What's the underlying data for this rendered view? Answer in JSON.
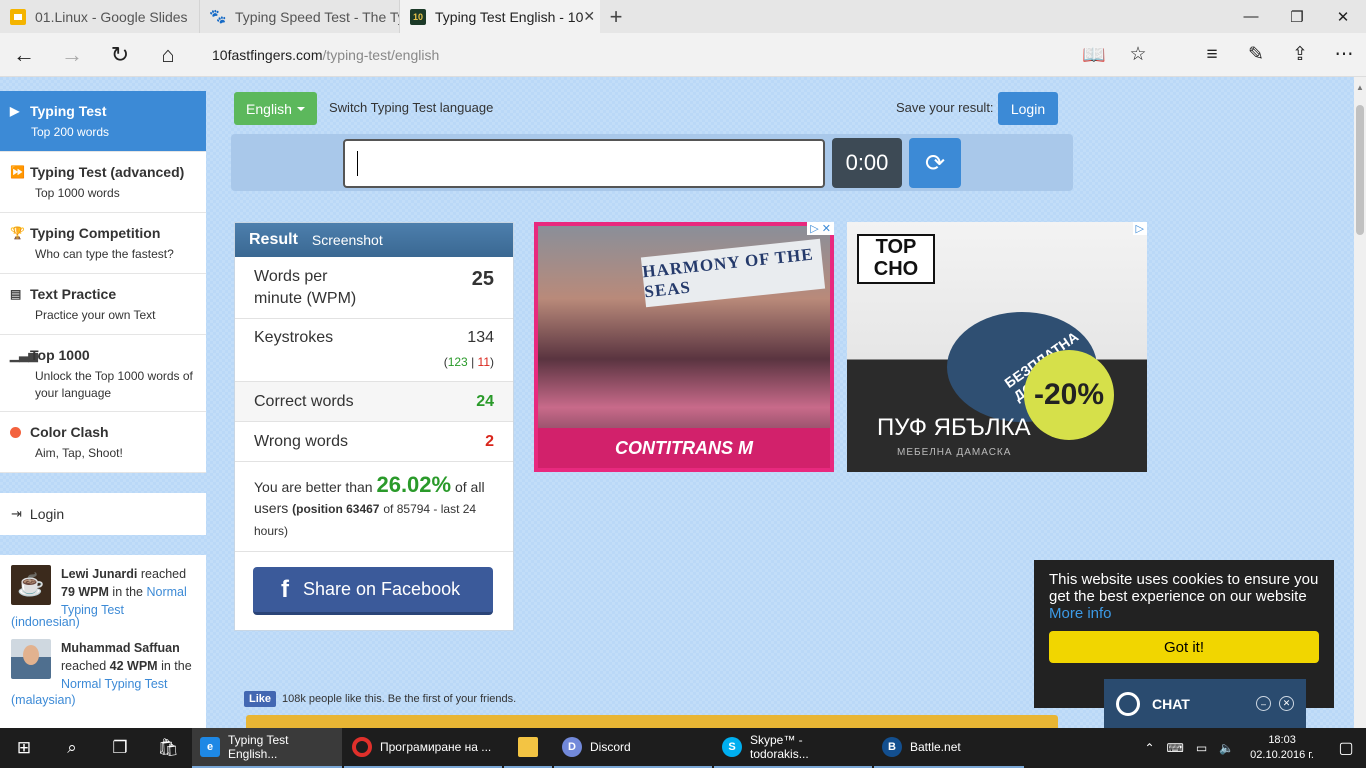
{
  "browser": {
    "tabs": [
      {
        "title": "01.Linux - Google Slides",
        "icon": "slides-icon"
      },
      {
        "title": "Typing Speed Test - The Typ",
        "icon": "paw-icon"
      },
      {
        "title": "Typing Test English - 10",
        "icon": "10ff-icon",
        "active": true
      }
    ],
    "url_host": "10fastfingers.com",
    "url_path": "/typing-test/english"
  },
  "sidebar": {
    "items": [
      {
        "title": "Typing Test",
        "subtitle": "Top 200 words",
        "icon": "play-icon",
        "active": true
      },
      {
        "title": "Typing Test (advanced)",
        "subtitle": "Top 1000 words",
        "icon": "fast-forward-icon"
      },
      {
        "title": "Typing Competition",
        "subtitle": "Who can type the fastest?",
        "icon": "trophy-icon"
      },
      {
        "title": "Text Practice",
        "subtitle": "Practice your own Text",
        "icon": "document-icon"
      },
      {
        "title": "Top 1000",
        "subtitle": "Unlock the Top 1000 words of your language",
        "icon": "signal-bars-icon"
      },
      {
        "title": "Color Clash",
        "subtitle": "Aim, Tap, Shoot!",
        "icon": "red-dot-icon"
      }
    ],
    "login": "Login",
    "activity": [
      {
        "user": "Lewi Junardi",
        "reached": "reached",
        "wpm": "79 WPM",
        "in_the": "in the",
        "link": "Normal Typing Test",
        "lang": "(indonesian)"
      },
      {
        "user": "Muhammad Saffuan",
        "reached": "reached",
        "wpm": "42 WPM",
        "in_the": "in the",
        "link": "Normal Typing Test",
        "lang": "(malaysian)"
      }
    ]
  },
  "controls": {
    "language": "English",
    "switch_label": "Switch Typing Test language",
    "save_label": "Save your result:",
    "login": "Login",
    "timer": "0:00"
  },
  "result": {
    "title": "Result",
    "screenshot": "Screenshot",
    "wpm_label_1": "Words per",
    "wpm_label_2": "minute (WPM)",
    "wpm": "25",
    "keystrokes_label": "Keystrokes",
    "keystrokes": "134",
    "keystrokes_correct": "123",
    "keystrokes_wrong": "11",
    "correct_label": "Correct words",
    "correct": "24",
    "wrong_label": "Wrong words",
    "wrong": "2",
    "better_1": "You are better than",
    "better_pct": "26.02%",
    "better_2": "of all users",
    "position": "(position 63467",
    "position_rest": "of 85794 - last 24 hours)",
    "share": "Share on Facebook"
  },
  "ads": {
    "ad1_ship": "HARMONY OF THE SEAS",
    "ad1_brand": "CONTITRANS M",
    "ad2_logo": "TOP CHO",
    "ad2_delivery": "БЕЗПЛАТНА ДОСТАВКА",
    "ad2_discount": "-20%",
    "ad2_title": "ПУФ ЯБЪЛКА",
    "ad2_sub": "МЕБЕЛНА ДАМАСКА"
  },
  "fb_like": {
    "button": "Like",
    "text": "108k people like this. Be the first of your friends."
  },
  "cookie": {
    "text": "This website uses cookies to ensure you get the best experience on our website",
    "more": "More info",
    "button": "Got it!"
  },
  "chat": {
    "label": "CHAT"
  },
  "taskbar": {
    "apps": [
      {
        "label": "Typing Test English...",
        "icon": "edge",
        "active": true
      },
      {
        "label": "Програмиране на ...",
        "icon": "opera"
      },
      {
        "label": "",
        "icon": "folder"
      },
      {
        "label": "Discord",
        "icon": "discord"
      },
      {
        "label": "Skype™ - todorakis...",
        "icon": "skype"
      },
      {
        "label": "Battle.net",
        "icon": "bnet"
      }
    ],
    "time": "18:03",
    "date": "02.10.2016 г."
  }
}
